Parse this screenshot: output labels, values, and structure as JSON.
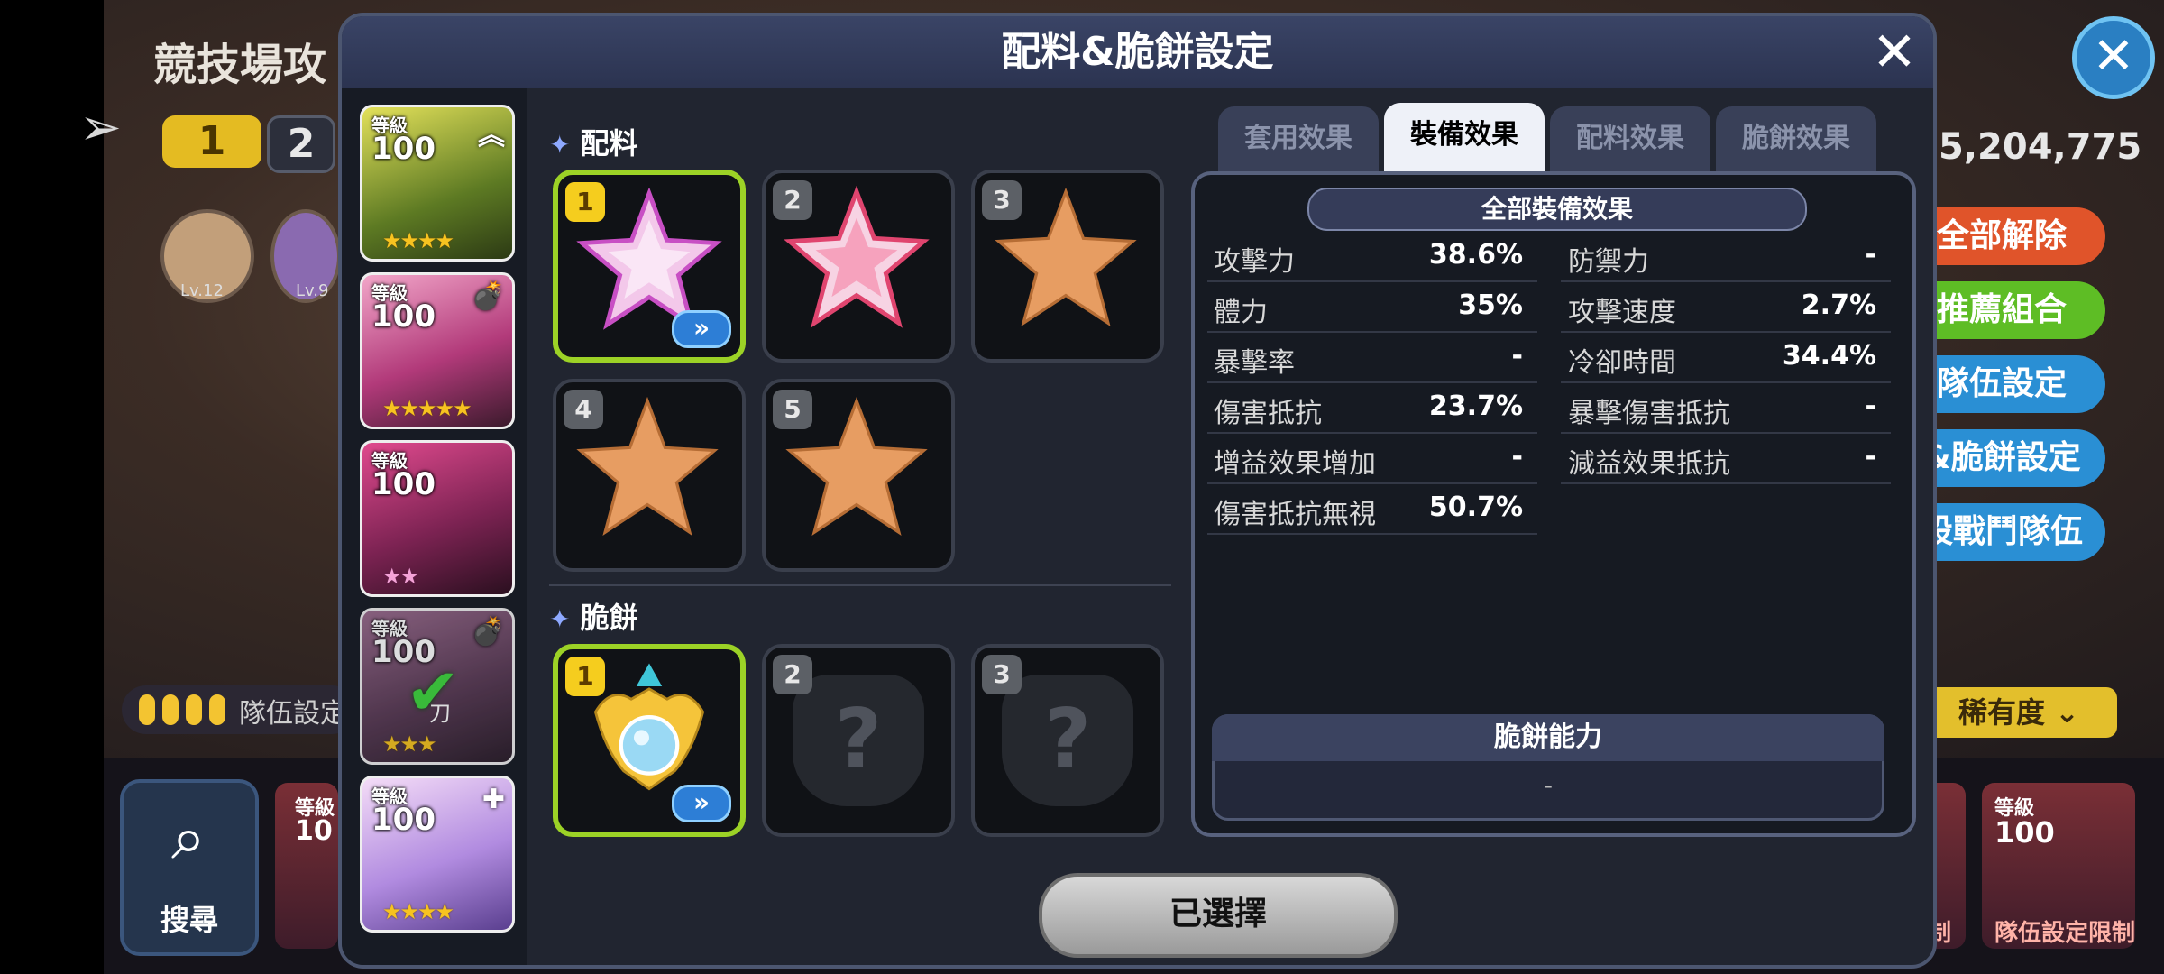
{
  "background": {
    "title": "競技場攻",
    "tabs": [
      "1",
      "2"
    ],
    "levels": [
      "Lv.12",
      "Lv.9"
    ],
    "team_label": "隊伍設定",
    "search_label": "搜尋",
    "score": "5,204,775",
    "buttons": [
      "全部解除",
      "推薦組合",
      "隊伍設定",
      "&脆餅設定",
      "設戰鬥隊伍"
    ],
    "rarity_label": "稀有度",
    "card_limit_label": "隊伍設定限制",
    "card_limit_short": "制",
    "card_level_label": "等級",
    "card_level_value": "100",
    "card_level_partial": "10",
    "colors": {
      "yellow_tab": "#f3c431",
      "red_btn": "#e0542a",
      "green_btn": "#5ebd25",
      "blue_btn": "#2a8fd4"
    }
  },
  "modal": {
    "title": "配料&脆餅設定",
    "close_icon": "close-icon",
    "characters": [
      {
        "level_label": "等級",
        "level": "100",
        "stars": "★★★★",
        "star_color": "gold",
        "corner": "︽"
      },
      {
        "level_label": "等級",
        "level": "100",
        "stars": "★★★★★",
        "star_color": "gold",
        "corner": "💣"
      },
      {
        "level_label": "等級",
        "level": "100",
        "stars": "★★",
        "star_color": "pink",
        "corner": ""
      },
      {
        "level_label": "等級",
        "level": "100",
        "stars": "★★★",
        "star_color": "gold",
        "corner": "💣",
        "checked": true,
        "note": "刀"
      },
      {
        "level_label": "等級",
        "level": "100",
        "stars": "★★★★",
        "star_color": "gold",
        "corner": "✚"
      }
    ],
    "toppings": {
      "label": "配料",
      "slots": [
        {
          "num": "1",
          "state": "equipped-selected"
        },
        {
          "num": "2",
          "state": "equipped"
        },
        {
          "num": "3",
          "state": "empty"
        },
        {
          "num": "4",
          "state": "empty"
        },
        {
          "num": "5",
          "state": "empty"
        }
      ]
    },
    "tart": {
      "label": "脆餅",
      "slots": [
        {
          "num": "1",
          "state": "equipped-selected"
        },
        {
          "num": "2",
          "state": "locked",
          "mark": "?"
        },
        {
          "num": "3",
          "state": "locked",
          "mark": "?"
        }
      ]
    },
    "tabs": [
      {
        "label": "套用效果",
        "active": false
      },
      {
        "label": "裝備效果",
        "active": true
      },
      {
        "label": "配料效果",
        "active": false
      },
      {
        "label": "脆餅效果",
        "active": false
      }
    ],
    "effects": {
      "header": "全部裝備效果",
      "left": [
        {
          "label": "攻擊力",
          "value": "38.6%"
        },
        {
          "label": "體力",
          "value": "35%"
        },
        {
          "label": "暴擊率",
          "value": "-"
        },
        {
          "label": "傷害抵抗",
          "value": "23.7%"
        },
        {
          "label": "增益效果增加",
          "value": "-"
        },
        {
          "label": "傷害抵抗無視",
          "value": "50.7%"
        }
      ],
      "right": [
        {
          "label": "防禦力",
          "value": "-"
        },
        {
          "label": "攻擊速度",
          "value": "2.7%"
        },
        {
          "label": "冷卻時間",
          "value": "34.4%"
        },
        {
          "label": "暴擊傷害抵抗",
          "value": "-"
        },
        {
          "label": "減益效果抵抗",
          "value": "-"
        }
      ]
    },
    "ability": {
      "title": "脆餅能力",
      "value": "-"
    },
    "confirm_label": "已選擇",
    "arrow_icon": "double-chevron-icon"
  }
}
